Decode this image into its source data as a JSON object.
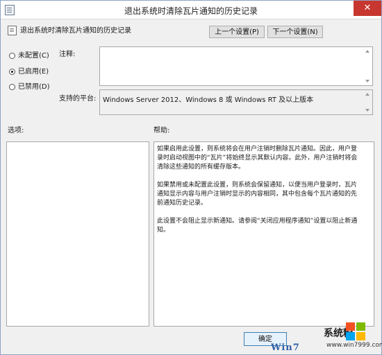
{
  "window": {
    "title": "退出系统时清除瓦片通知的历史记录",
    "close_glyph": "✕"
  },
  "policy_name": "退出系统时清除瓦片通知的历史记录",
  "nav": {
    "prev_label": "上一个设置(P)",
    "next_label": "下一个设置(N)"
  },
  "state": {
    "options": [
      {
        "label": "未配置(C)",
        "checked": false
      },
      {
        "label": "已启用(E)",
        "checked": true
      },
      {
        "label": "已禁用(D)",
        "checked": false
      }
    ]
  },
  "comment": {
    "label": "注释:",
    "value": ""
  },
  "platform": {
    "label": "支持的平台:",
    "value": "Windows Server 2012、Windows 8 或 Windows RT 及以上版本"
  },
  "options_section": {
    "label": "选项:"
  },
  "help_section": {
    "label": "帮助:",
    "paragraphs": [
      "如果启用此设置，则系统将会在用户注销时删除瓦片通知。因此，用户登录时启动视图中的“瓦片”将始终显示其默认内容。此外，用户注销时将会清除这些通知的所有缓存版本。",
      "如果禁用或未配置此设置，则系统会保留通知，以便当用户登录时，瓦片通知显示内容与用户注销时显示的内容相同，其中包含每个瓦片通知的先前通知历史记录。",
      "此设置不会阻止显示新通知。请参阅“关闭应用程序通知”设置以阻止新通知。"
    ]
  },
  "footer": {
    "ok_label": "确定"
  },
  "watermark": {
    "text": "Win7",
    "brand": "系统粉",
    "url": "www.win7999.com"
  },
  "colors": {
    "logo_red": "#f25022",
    "logo_green": "#7fba00",
    "logo_blue": "#00a4ef",
    "logo_yellow": "#ffb900"
  }
}
